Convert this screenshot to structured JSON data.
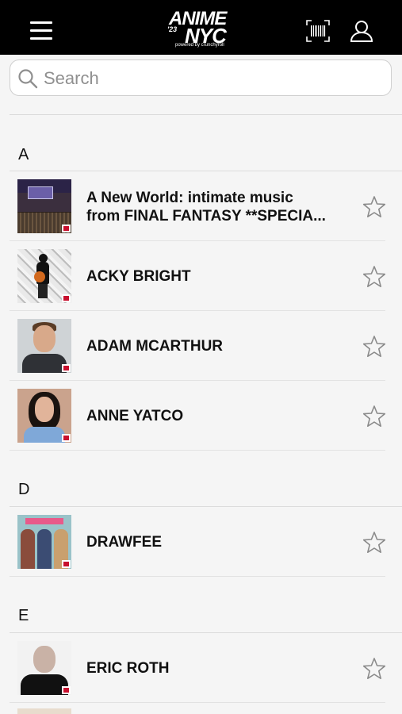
{
  "header": {
    "logo_line1": "ANIME",
    "logo_line2": "NYC",
    "logo_tag": "'23",
    "logo_powered": "powered by crunchyroll",
    "icons": [
      "hamburger-menu-icon",
      "barcode-scan-icon",
      "profile-icon"
    ]
  },
  "search": {
    "placeholder": "Search",
    "value": ""
  },
  "sections": [
    {
      "letter": "A",
      "items": [
        {
          "name_line1": "A New World: intimate music",
          "name_line2": "from FINAL FANTASY **SPECIA...",
          "favorited": false
        },
        {
          "name": "ACKY BRIGHT",
          "favorited": false
        },
        {
          "name": "ADAM MCARTHUR",
          "favorited": false
        },
        {
          "name": "ANNE YATCO",
          "favorited": false
        }
      ]
    },
    {
      "letter": "D",
      "items": [
        {
          "name": "DRAWFEE",
          "favorited": false
        }
      ]
    },
    {
      "letter": "E",
      "items": [
        {
          "name": "ERIC ROTH",
          "favorited": false
        }
      ]
    }
  ],
  "colors": {
    "header_bg": "#000000",
    "page_bg": "#f5f5f5",
    "star_outline": "#8a8a8a"
  }
}
